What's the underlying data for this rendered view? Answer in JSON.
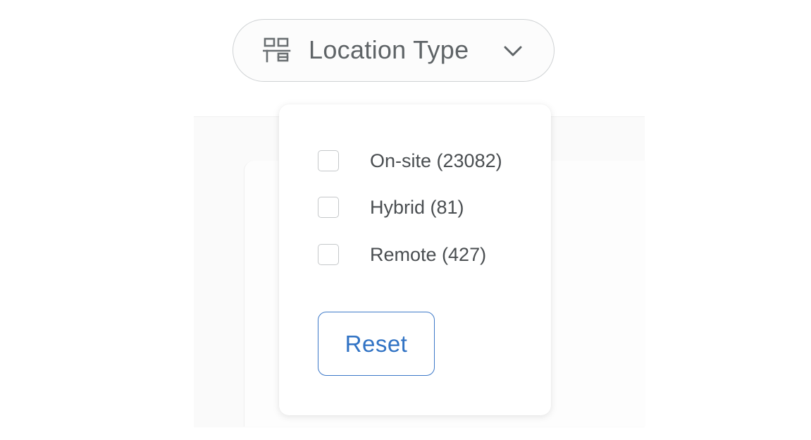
{
  "filter": {
    "label": "Location Type",
    "icon": "desk-icon",
    "chevron_icon": "chevron-down-icon",
    "expanded": true
  },
  "dropdown": {
    "options": [
      {
        "label": "On-site (23082)",
        "checked": false
      },
      {
        "label": "Hybrid (81)",
        "checked": false
      },
      {
        "label": "Remote (427)",
        "checked": false
      }
    ],
    "reset_label": "Reset"
  },
  "colors": {
    "accent": "#3173c4",
    "text": "#4a4e51",
    "muted_text": "#5f6467",
    "border": "#cfd2d4"
  }
}
